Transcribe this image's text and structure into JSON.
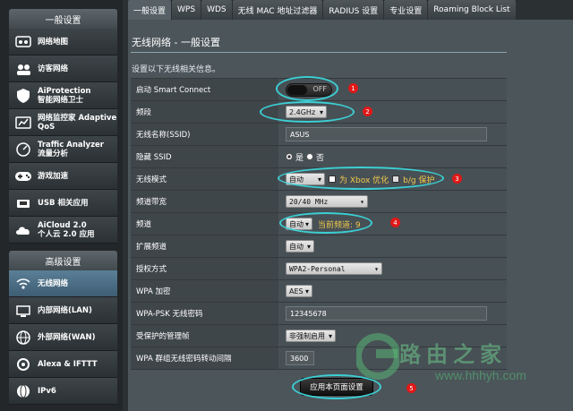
{
  "sidebar": {
    "general_header": "一般设置",
    "general_items": [
      {
        "label": "网络地图",
        "icon": "network-map-icon"
      },
      {
        "label": "访客网络",
        "icon": "guest-network-icon"
      },
      {
        "label": "AiProtection\n智能网络卫士",
        "icon": "aiprotection-icon"
      },
      {
        "label": "网络监控家 Adaptive\nQoS",
        "icon": "adaptive-qos-icon"
      },
      {
        "label": "Traffic Analyzer\n流量分析",
        "icon": "traffic-analyzer-icon"
      },
      {
        "label": "游戏加速",
        "icon": "game-boost-icon"
      },
      {
        "label": "USB 相关应用",
        "icon": "usb-icon"
      },
      {
        "label": "AiCloud 2.0\n个人云 2.0 应用",
        "icon": "aicloud-icon"
      }
    ],
    "advanced_header": "高级设置",
    "advanced_items": [
      {
        "label": "无线网络",
        "icon": "wireless-icon",
        "active": true
      },
      {
        "label": "内部网络(LAN)",
        "icon": "lan-icon"
      },
      {
        "label": "外部网络(WAN)",
        "icon": "wan-icon"
      },
      {
        "label": "Alexa & IFTTT",
        "icon": "alexa-icon"
      },
      {
        "label": "IPv6",
        "icon": "ipv6-icon"
      }
    ]
  },
  "tabs": [
    "一般设置",
    "WPS",
    "WDS",
    "无线 MAC 地址过滤器",
    "RADIUS 设置",
    "专业设置",
    "Roaming Block List"
  ],
  "page": {
    "title": "无线网络 - 一般设置",
    "description": "设置以下无线相关信息。"
  },
  "form": {
    "smart_connect": {
      "label": "启动 Smart Connect",
      "value": "OFF"
    },
    "band": {
      "label": "频段",
      "value": "2.4GHz"
    },
    "ssid": {
      "label": "无线名称(SSID)",
      "value": "ASUS"
    },
    "hide_ssid": {
      "label": "隐藏 SSID",
      "yes": "是",
      "no": "否"
    },
    "wireless_mode": {
      "label": "无线模式",
      "value": "自动",
      "xbox": "为 Xbox 优化",
      "bg": "b/g 保护"
    },
    "bandwidth": {
      "label": "频道带宽",
      "value": "20/40 MHz"
    },
    "channel": {
      "label": "频道",
      "value": "自动",
      "current": "当前频道: 9"
    },
    "ext_channel": {
      "label": "扩展频道",
      "value": "自动"
    },
    "auth": {
      "label": "授权方式",
      "value": "WPA2-Personal"
    },
    "wpa_enc": {
      "label": "WPA 加密",
      "value": "AES"
    },
    "wpa_psk": {
      "label": "WPA-PSK 无线密码",
      "value": "12345678"
    },
    "pmf": {
      "label": "受保护的管理帧",
      "value": "非强制启用"
    },
    "rekey": {
      "label": "WPA 群组无线密码转动间隔",
      "value": "3600"
    }
  },
  "apply_label": "应用本页面设置",
  "annotations": [
    "1",
    "2",
    "3",
    "4",
    "5"
  ],
  "watermark": {
    "text": "路由之家",
    "url": "www.hhhyh.com"
  },
  "colors": {
    "annotation": "#3ccfd4",
    "badge": "#e01818",
    "current_channel": "#f2c94c"
  }
}
